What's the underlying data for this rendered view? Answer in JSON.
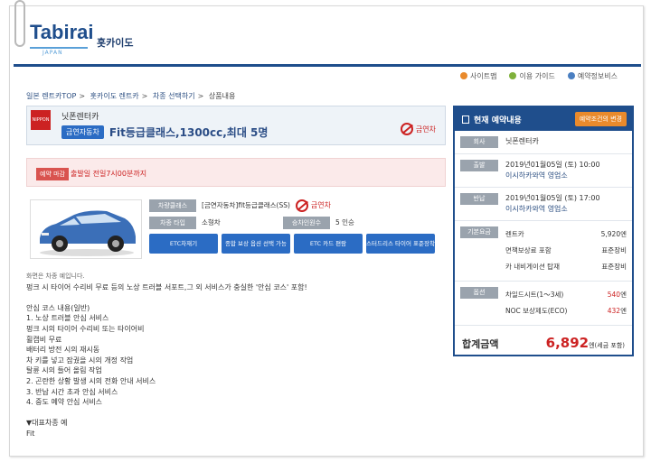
{
  "header": {
    "logo_text": "Tabirai",
    "logo_sub": "JAPAN",
    "region": "홋카이도"
  },
  "toplinks": [
    {
      "label": "사이트맵",
      "color": "#e98a2c"
    },
    {
      "label": "이용 가이드",
      "color": "#7fb13b"
    },
    {
      "label": "예약정보비스",
      "color": "#4a7fc1"
    }
  ],
  "breadcrumb": {
    "items": [
      "일본 렌트카TOP",
      "홋카이도 렌트카",
      "차종 선택하기"
    ],
    "current": "상품내용"
  },
  "car": {
    "logo_label": "NIPPON",
    "company": "닛폰렌터카",
    "smoke_tag": "금연자동차",
    "class_title": "Fit등급클래스,1300cc,최대 5명",
    "nosmoke": "금연차",
    "deadline_label": "예약 마감",
    "deadline_text": "출발일 전일7시00분까지",
    "spec": {
      "class_label": "차량클래스",
      "class_value": "[금연자동차]fit등급클래스(SS)",
      "class_nosmoke": "금연차",
      "type_label": "차종 타입",
      "type_value": "소형차",
      "cap_label": "승차인원수",
      "cap_value": "5 인승"
    },
    "buttons": [
      "ETC차재기",
      "종합 보상 옵션 선택 가능",
      "ETC 카드 편람",
      "스터드리스 타이어 표준장착"
    ]
  },
  "description": {
    "note": "화면은 차종 예입니다.",
    "line1": "펑크 시 타이어 수리비 무료 등의 노상 트러블 서포트,그 외 서비스가 충실한 '안심 코스' 포함!",
    "blank": "",
    "lines": [
      "안심 코스 내용(일반)",
      "1. 노상 트러블 안심 서비스",
      "펑크 시의 타이어 수리비 또는 타이어비",
      "휠캡비 무료",
      "배터리 방전 시의 재시동",
      "차 키를 넣고 잠궜을 시의 개정 작업",
      "탈륜 시의 들어 올림 작업",
      "2. 곤란한 상황 발생 시의 전화 안내 서비스",
      "3. 반납 시간 초과 안심 서비스",
      "4. 중도 예약 안심 서비스"
    ],
    "rep_title": "▼대표차종 예",
    "rep_value": "Fit"
  },
  "side": {
    "title": "현재 예약내용",
    "change": "예약조건의 변경",
    "company_label": "회사",
    "company": "닛폰렌터카",
    "depart_label": "출발",
    "depart_date": "2019년01월05일 (토) 10:00",
    "depart_place": "이시하카와역 영업소",
    "return_label": "반납",
    "return_date": "2019년01월05일 (토) 17:00",
    "return_place": "이시하카와역 영업소",
    "basic_label": "기본요금",
    "basic": [
      {
        "name": "렌트카",
        "value": "5,920엔"
      },
      {
        "name": "면책보상료 포함",
        "value": "표준장비"
      },
      {
        "name": "카 내비게이션 탑재",
        "value": "표준장비"
      }
    ],
    "option_label": "옵션",
    "options": [
      {
        "name": "차일드시트(1～3세)",
        "value": "540",
        "unit": "엔"
      },
      {
        "name": "NOC 보상제도(ECO)",
        "value": "432",
        "unit": "엔"
      }
    ],
    "total_label": "합계금액",
    "total_value": "6,892",
    "total_unit": "엔(세금 포함)"
  }
}
